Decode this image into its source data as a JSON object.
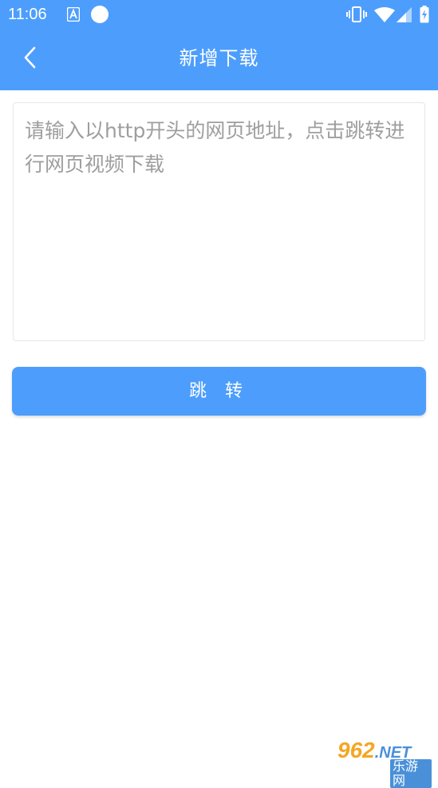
{
  "status_bar": {
    "time": "11:06",
    "left_icons": [
      "font-app-icon",
      "circle-notification-icon"
    ],
    "right_icons": [
      "vibrate-icon",
      "wifi-icon",
      "signal-icon",
      "battery-charging-icon"
    ]
  },
  "app_bar": {
    "title": "新增下载",
    "back_icon": "chevron-left-icon"
  },
  "url_input": {
    "placeholder": "请输入以http开头的网页地址，点击跳转进行网页视频下载",
    "value": ""
  },
  "jump_button": {
    "label": "跳 转"
  },
  "watermark": {
    "brand": "962",
    "suffix": ".NET",
    "subtitle": "乐游网"
  },
  "colors": {
    "accent": "#4d9efc",
    "placeholder": "#9e9e9e",
    "border": "#e6e6e6"
  }
}
